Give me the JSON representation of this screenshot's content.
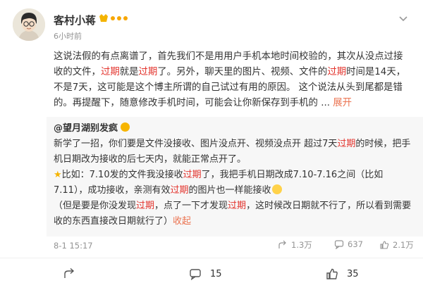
{
  "post": {
    "author": "客村小蒋",
    "time": "6小时前",
    "body_segments": [
      {
        "t": "这说法假的有点离谱了，首先我们不是用用户手机本地时间校验的，其次从没点过接收的文件，",
        "c": ""
      },
      {
        "t": "过期",
        "c": "red"
      },
      {
        "t": "就是",
        "c": ""
      },
      {
        "t": "过期",
        "c": "red"
      },
      {
        "t": "了。另外，聊天里的图片、视频、文件的",
        "c": ""
      },
      {
        "t": "过期",
        "c": "red"
      },
      {
        "t": "时间是14天，不是7天，这可能是这个博主所谓的自己试过有用的原因。  这个说法从头到尾都是错的。再提醒下，随意修改手机时间，可能会让你新保存到手机的 ... ",
        "c": ""
      }
    ],
    "expand_label": "展开"
  },
  "repost": {
    "author": "@望月湖别发疯",
    "para1_segments": [
      {
        "t": "新学了一招，你们要是文件没接收、图片没点开、视频没点开 超过7天",
        "c": ""
      },
      {
        "t": "过期",
        "c": "red"
      },
      {
        "t": "的时候，把手机日期改为接收的后七天内，就能正常点开了。",
        "c": ""
      }
    ],
    "para2_segments": [
      {
        "t": "比如：7.10发的文件我没接收",
        "c": ""
      },
      {
        "t": "过期",
        "c": "red"
      },
      {
        "t": "了，我把手机日期改成7.10-7.16之间（比如7.11），成功接收，亲测有效",
        "c": ""
      },
      {
        "t": "过期",
        "c": "red"
      },
      {
        "t": "的图片也一样能接收",
        "c": ""
      }
    ],
    "para3_segments": [
      {
        "t": "（但是要是你没发现",
        "c": ""
      },
      {
        "t": "过期",
        "c": "red"
      },
      {
        "t": "，点了一下才发现",
        "c": ""
      },
      {
        "t": "过期",
        "c": "red"
      },
      {
        "t": "，这时候改日期就不行了，所以看到需要收的东西直接改日期就行了）",
        "c": ""
      }
    ],
    "collapse_label": "收起",
    "date": "8-1 15:17",
    "reposts": "1.3万",
    "comments": "637",
    "likes": "2.1万"
  },
  "actions": {
    "repost_count": "",
    "comment_count": "15",
    "like_count": "35"
  },
  "colors": {
    "accent": "#eb7350",
    "highlight": "#e3332c",
    "repost_bg": "#f7f7f7"
  }
}
